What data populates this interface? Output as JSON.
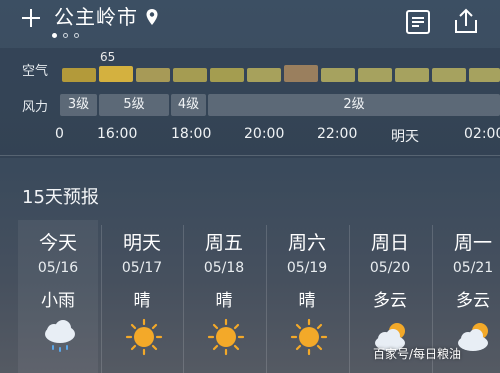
{
  "header": {
    "city": "公主岭市",
    "icons": {
      "add": "plus-icon",
      "location": "location-pin-icon",
      "list": "list-icon",
      "share": "share-icon"
    },
    "page_dots": 3,
    "active_dot": 0
  },
  "hourly": {
    "air_label": "空气",
    "wind_label": "风力",
    "aqi_highlight_value": "65",
    "aqi_levels": [
      {
        "level": "good",
        "color": "#b39a3a"
      },
      {
        "level": "good-highlight",
        "color": "#d4b13f"
      },
      {
        "level": "good",
        "color": "#a79a57"
      },
      {
        "level": "good",
        "color": "#a59c52"
      },
      {
        "level": "good",
        "color": "#a49d50"
      },
      {
        "level": "good",
        "color": "#a7a15c"
      },
      {
        "level": "moderate",
        "color": "#9a7f5e"
      },
      {
        "level": "good",
        "color": "#a6a25f"
      },
      {
        "level": "good",
        "color": "#a6a25f"
      },
      {
        "level": "good",
        "color": "#a6a25f"
      },
      {
        "level": "good",
        "color": "#a6a25f"
      },
      {
        "level": "good",
        "color": "#a6a25f"
      }
    ],
    "wind_segments": [
      "3级",
      "5级",
      "4级",
      "2级"
    ],
    "times": [
      "0",
      "16:00",
      "18:00",
      "20:00",
      "22:00",
      "明天",
      "02:00"
    ]
  },
  "forecast": {
    "title": "15天预报",
    "days": [
      {
        "name": "今天",
        "date": "05/16",
        "condition": "小雨",
        "icon": "light-rain-icon"
      },
      {
        "name": "明天",
        "date": "05/17",
        "condition": "晴",
        "icon": "sun-icon"
      },
      {
        "name": "周五",
        "date": "05/18",
        "condition": "晴",
        "icon": "sun-icon"
      },
      {
        "name": "周六",
        "date": "05/19",
        "condition": "晴",
        "icon": "sun-icon"
      },
      {
        "name": "周日",
        "date": "05/20",
        "condition": "多云",
        "icon": "partly-cloudy-icon"
      },
      {
        "name": "周一",
        "date": "05/21",
        "condition": "多云",
        "icon": "partly-cloudy-icon"
      }
    ]
  },
  "watermark": "百家号/每日粮油",
  "colors": {
    "sun": "#f3a929",
    "cloud": "#e8eef5",
    "rain": "#5aa6e8"
  }
}
